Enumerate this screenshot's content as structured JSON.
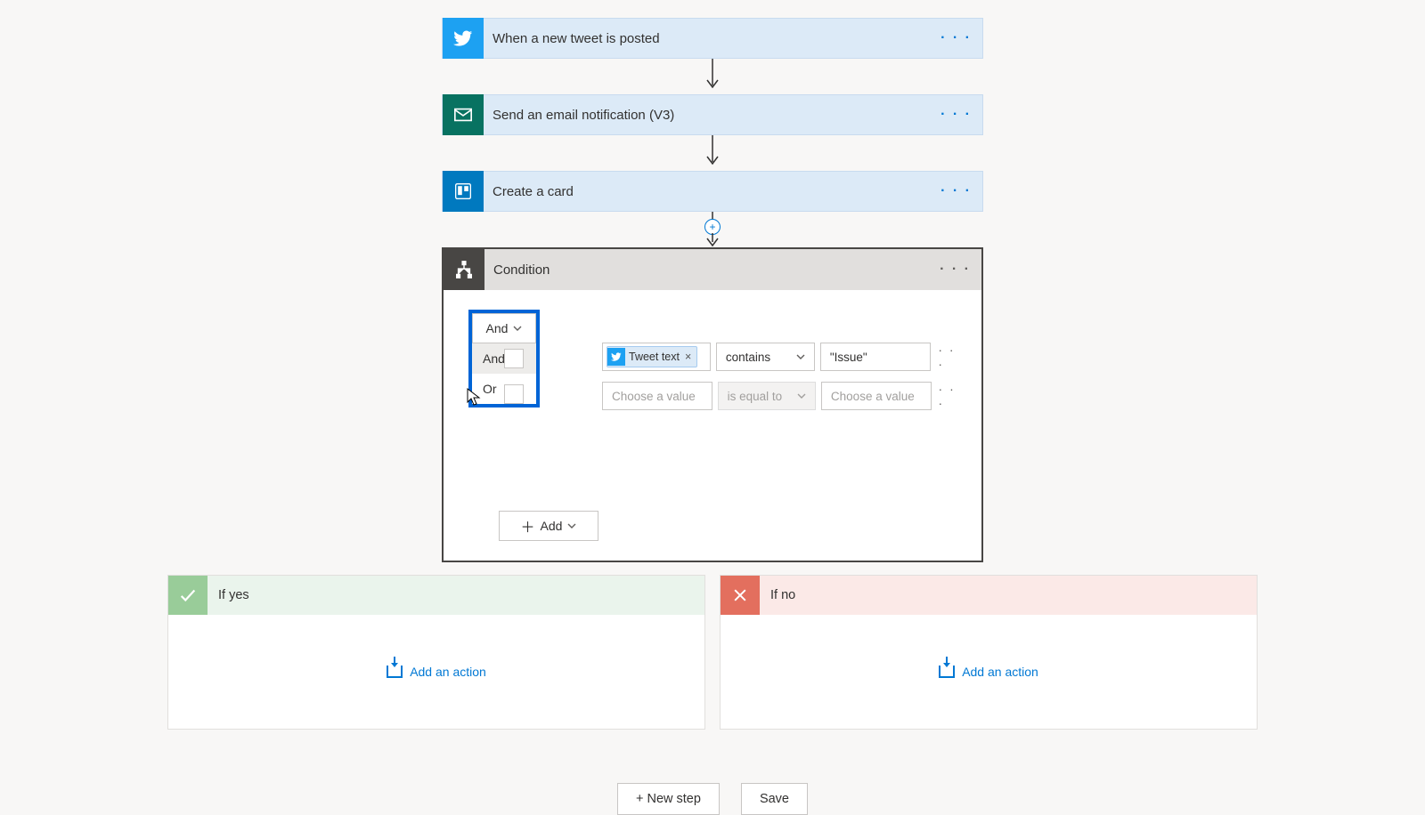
{
  "steps": [
    {
      "title": "When a new tweet is posted",
      "connector": "twitter"
    },
    {
      "title": "Send an email notification (V3)",
      "connector": "mail"
    },
    {
      "title": "Create a card",
      "connector": "trello"
    }
  ],
  "condition": {
    "title": "Condition",
    "logic_selected": "And",
    "logic_options": [
      "And",
      "Or"
    ],
    "rows": [
      {
        "left_token_label": "Tweet text",
        "operator": "contains",
        "operator_disabled": false,
        "right_value": "\"Issue\"",
        "left_placeholder": null,
        "right_placeholder": null
      },
      {
        "left_token_label": null,
        "operator": "is equal to",
        "operator_disabled": true,
        "right_value": null,
        "left_placeholder": "Choose a value",
        "right_placeholder": "Choose a value"
      }
    ],
    "add_label": "Add"
  },
  "branches": {
    "yes": {
      "title": "If yes",
      "add_action_label": "Add an action"
    },
    "no": {
      "title": "If no",
      "add_action_label": "Add an action"
    }
  },
  "bottom": {
    "new_step": "+ New step",
    "save": "Save"
  }
}
